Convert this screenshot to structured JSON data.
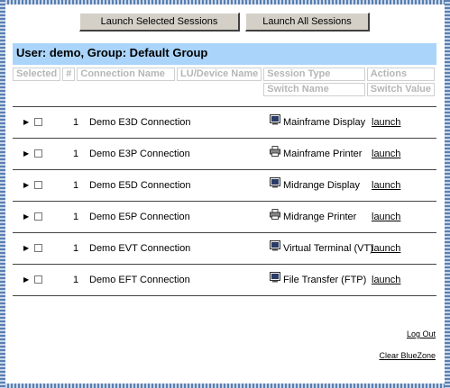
{
  "toolbar": {
    "launch_selected": "Launch Selected Sessions",
    "launch_all": "Launch All Sessions"
  },
  "group_header": "User: demo, Group: Default Group",
  "columns": {
    "selected": "Selected",
    "num": "#",
    "connection_name": "Connection Name",
    "lu_device": "LU/Device Name",
    "session_type": "Session Type",
    "switch_name": "Switch Name",
    "actions": "Actions",
    "switch_value": "Switch Value"
  },
  "sessions": [
    {
      "num": "1",
      "name": "Demo E3D Connection",
      "type": "Mainframe Display",
      "icon": "monitor-icon",
      "action": "launch"
    },
    {
      "num": "1",
      "name": "Demo E3P Connection",
      "type": "Mainframe Printer",
      "icon": "printer-icon",
      "action": "launch"
    },
    {
      "num": "1",
      "name": "Demo E5D Connection",
      "type": "Midrange Display",
      "icon": "monitor-icon",
      "action": "launch"
    },
    {
      "num": "1",
      "name": "Demo E5P Connection",
      "type": "Midrange Printer",
      "icon": "printer-icon",
      "action": "launch"
    },
    {
      "num": "1",
      "name": "Demo EVT Connection",
      "type": "Virtual Terminal (VT)",
      "icon": "monitor-icon",
      "action": "launch"
    },
    {
      "num": "1",
      "name": "Demo EFT Connection",
      "type": "File Transfer (FTP)",
      "icon": "monitor-icon",
      "action": "launch"
    }
  ],
  "footer": {
    "logout": "Log Out",
    "clear": "Clear BlueZone"
  },
  "colors": {
    "header_bg": "#aad4fa",
    "frame": "#5a7fb0"
  }
}
